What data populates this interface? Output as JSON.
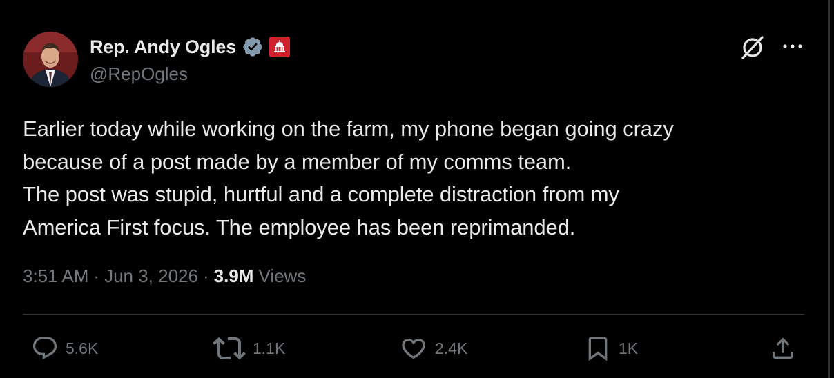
{
  "author": {
    "name": "Rep. Andy Ogles",
    "handle": "@RepOgles",
    "verified_icon": "verified-badge-icon",
    "affiliation_icon": "congress-affiliation-icon"
  },
  "tweet": {
    "lines": [
      "Earlier today while working on the farm, my phone began going crazy",
      "because of a post made by a member of my comms team.",
      "The post was stupid, hurtful and a complete distraction from my",
      "America First focus. The employee has been reprimanded."
    ],
    "time": "3:51 AM",
    "separator": "·",
    "date": "Jun 3, 2026",
    "views_count": "3.9M",
    "views_label": "Views"
  },
  "actions": {
    "replies": "5.6K",
    "reposts": "1.1K",
    "likes": "2.4K",
    "bookmarks": "1K"
  },
  "colors": {
    "background": "#000000",
    "text": "#e7e9ea",
    "muted": "#71767b",
    "verified": "#829aab",
    "affiliation": "#d0212e",
    "divider": "#2f3336"
  }
}
